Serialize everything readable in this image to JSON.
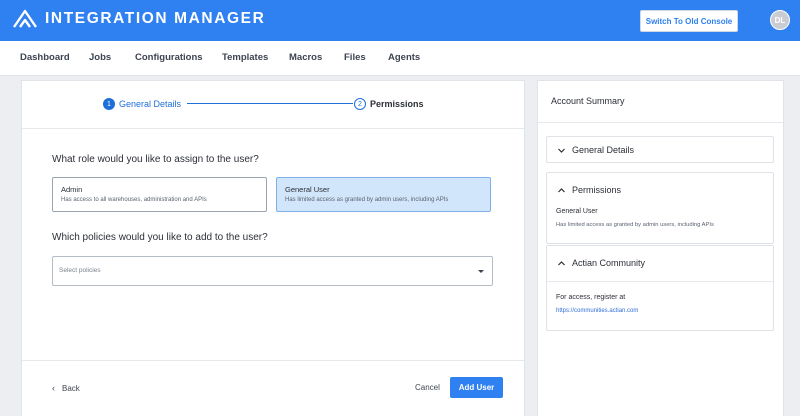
{
  "header": {
    "app_title": "INTEGRATION MANAGER",
    "switch_button_label": "Switch To Old Console",
    "avatar_initials": "DL",
    "brand_color": "#2f80f0"
  },
  "nav": {
    "items": [
      {
        "label": "Dashboard"
      },
      {
        "label": "Jobs"
      },
      {
        "label": "Configurations"
      },
      {
        "label": "Templates"
      },
      {
        "label": "Macros"
      },
      {
        "label": "Files"
      },
      {
        "label": "Agents"
      }
    ]
  },
  "stepper": {
    "steps": [
      {
        "number": "1",
        "label": "General Details",
        "state": "active"
      },
      {
        "number": "2",
        "label": "Permissions",
        "state": "current"
      }
    ]
  },
  "form": {
    "role_question": "What role would you like to assign to the user?",
    "roles": [
      {
        "name": "Admin",
        "description": "Has access to all warehouses, administration and APIs",
        "selected": false
      },
      {
        "name": "General User",
        "description": "Has limited access as granted by admin users, including APIs",
        "selected": true
      }
    ],
    "policy_question": "Which policies would you like to add to the user?",
    "policy_placeholder": "Select policies"
  },
  "footer": {
    "back_label": "Back",
    "cancel_label": "Cancel",
    "submit_label": "Add User"
  },
  "summary": {
    "title": "Account Summary",
    "sections": [
      {
        "title": "General Details",
        "expanded": false
      },
      {
        "title": "Permissions",
        "expanded": true,
        "role_name": "General User",
        "role_description": "Has limited access as granted by admin users, including APIs"
      },
      {
        "title": "Actian Community",
        "expanded": true,
        "text": "For access, register at",
        "link": "https://communities.actian.com"
      }
    ]
  }
}
